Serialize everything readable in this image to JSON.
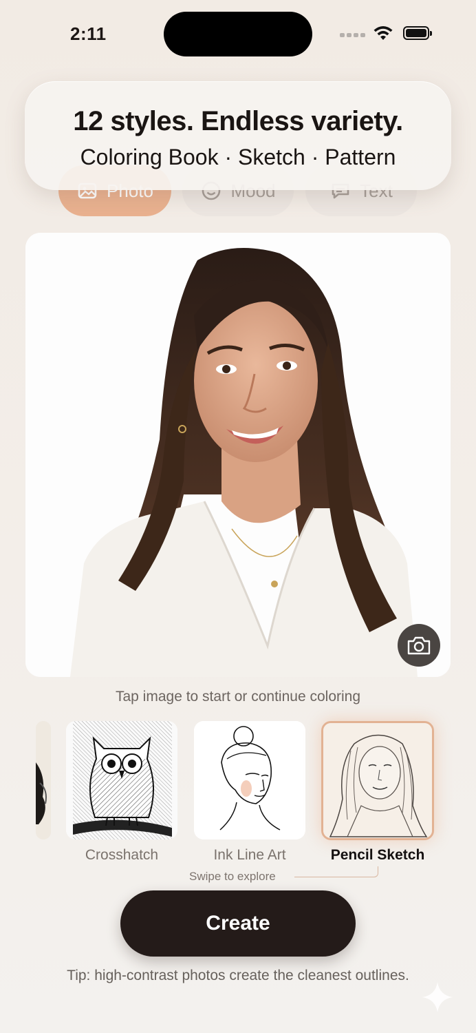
{
  "status_bar": {
    "time": "2:11"
  },
  "banner": {
    "title": "12 styles. Endless variety.",
    "subtitle": "Coloring Book · Sketch · Pattern"
  },
  "tabs": [
    {
      "label": "Photo",
      "icon": "image-icon",
      "active": true
    },
    {
      "label": "Mood",
      "icon": "smiley-icon",
      "active": false
    },
    {
      "label": "Text",
      "icon": "chat-bubble-icon",
      "active": false
    }
  ],
  "photo": {
    "icon": "camera-icon"
  },
  "hint": "Tap image to start or continue coloring",
  "styles": [
    {
      "label": "Crosshatch",
      "selected": false
    },
    {
      "label": "Ink Line Art",
      "selected": false
    },
    {
      "label": "Pencil Sketch",
      "selected": true
    }
  ],
  "swipe_hint": "Swipe to explore",
  "create_button": "Create",
  "tip": "Tip: high-contrast photos create the cleanest outlines.",
  "colors": {
    "accent": "#e9b18f",
    "primary_button": "#241b19",
    "selected_border": "#e2b293"
  }
}
